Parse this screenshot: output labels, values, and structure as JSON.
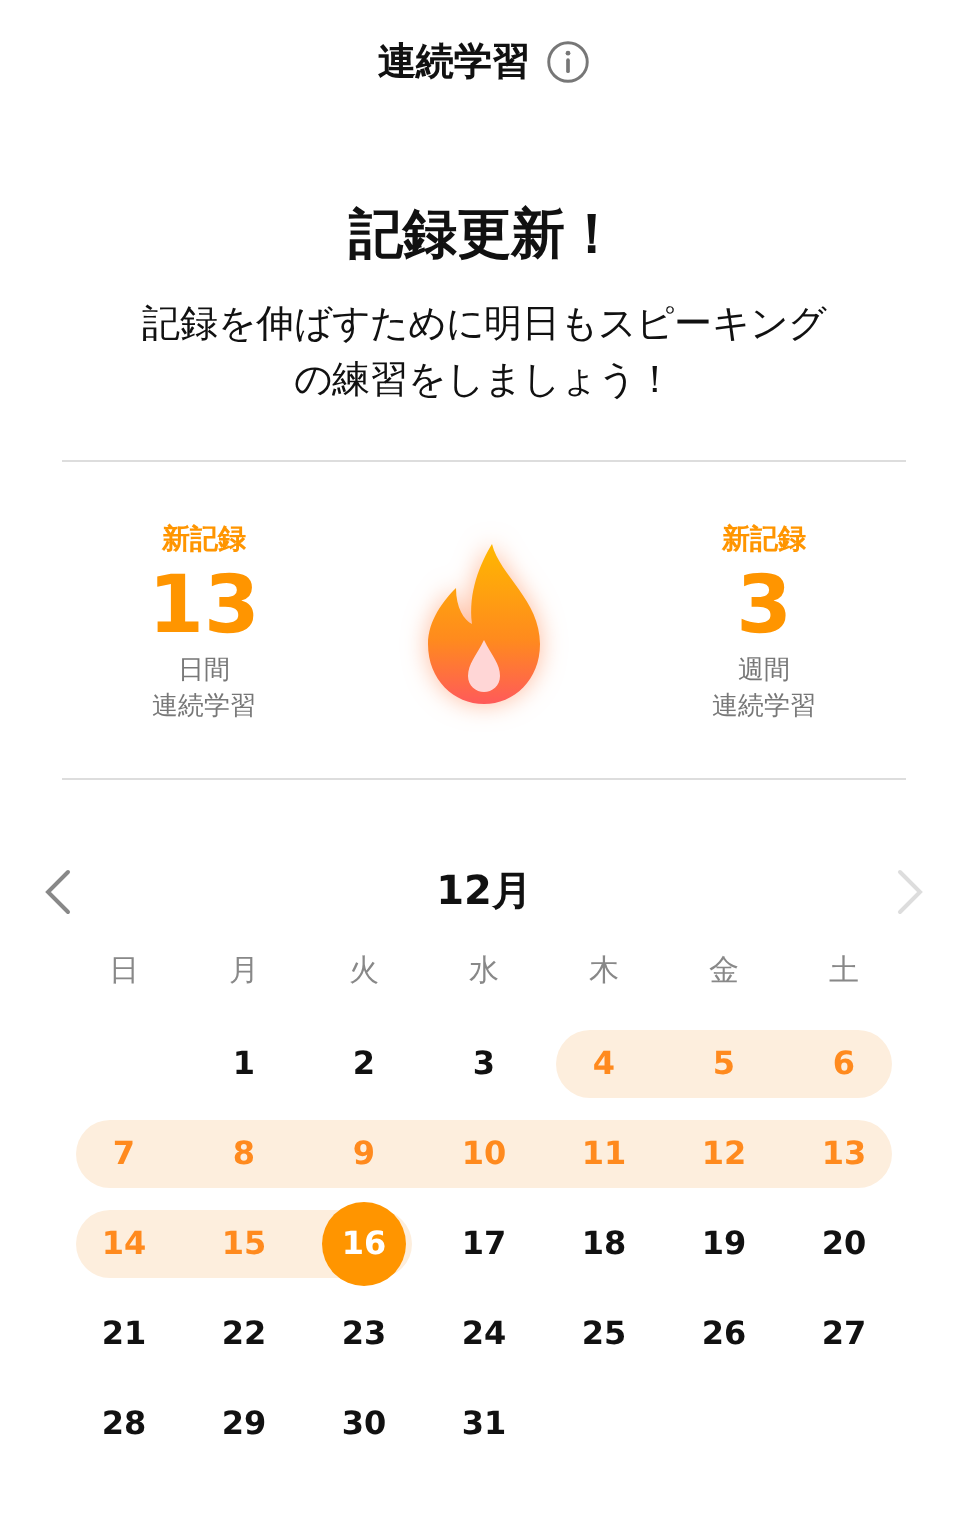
{
  "header": {
    "title": "連続学習"
  },
  "headline": "記録更新！",
  "message": "記録を伸ばすために明日もスピーキングの練習をしましょう！",
  "stats": [
    {
      "badge": "新記録",
      "value": "13",
      "unit": "日間",
      "label": "連続学習"
    },
    {
      "badge": "新記録",
      "value": "3",
      "unit": "週間",
      "label": "連続学習"
    }
  ],
  "calendar": {
    "month": "12月",
    "prev": {
      "disabled": false
    },
    "next": {
      "disabled": true
    },
    "weekdays": [
      "日",
      "月",
      "火",
      "水",
      "木",
      "金",
      "土"
    ],
    "weeks": [
      [
        {
          "kind": "blank"
        },
        {
          "kind": "day",
          "day": "1",
          "streak": false,
          "today": false
        },
        {
          "kind": "day",
          "day": "2",
          "streak": false,
          "today": false
        },
        {
          "kind": "day",
          "day": "3",
          "streak": false,
          "today": false
        },
        {
          "kind": "day",
          "day": "4",
          "streak": true,
          "today": false
        },
        {
          "kind": "day",
          "day": "5",
          "streak": true,
          "today": false
        },
        {
          "kind": "day",
          "day": "6",
          "streak": true,
          "today": false
        }
      ],
      [
        {
          "kind": "day",
          "day": "7",
          "streak": true,
          "today": false
        },
        {
          "kind": "day",
          "day": "8",
          "streak": true,
          "today": false
        },
        {
          "kind": "day",
          "day": "9",
          "streak": true,
          "today": false
        },
        {
          "kind": "day",
          "day": "10",
          "streak": true,
          "today": false
        },
        {
          "kind": "day",
          "day": "11",
          "streak": true,
          "today": false
        },
        {
          "kind": "day",
          "day": "12",
          "streak": true,
          "today": false
        },
        {
          "kind": "day",
          "day": "13",
          "streak": true,
          "today": false
        }
      ],
      [
        {
          "kind": "day",
          "day": "14",
          "streak": true,
          "today": false
        },
        {
          "kind": "day",
          "day": "15",
          "streak": true,
          "today": false
        },
        {
          "kind": "day",
          "day": "16",
          "streak": true,
          "today": true
        },
        {
          "kind": "day",
          "day": "17",
          "streak": false,
          "today": false
        },
        {
          "kind": "day",
          "day": "18",
          "streak": false,
          "today": false
        },
        {
          "kind": "day",
          "day": "19",
          "streak": false,
          "today": false
        },
        {
          "kind": "day",
          "day": "20",
          "streak": false,
          "today": false
        }
      ],
      [
        {
          "kind": "day",
          "day": "21",
          "streak": false,
          "today": false
        },
        {
          "kind": "day",
          "day": "22",
          "streak": false,
          "today": false
        },
        {
          "kind": "day",
          "day": "23",
          "streak": false,
          "today": false
        },
        {
          "kind": "day",
          "day": "24",
          "streak": false,
          "today": false
        },
        {
          "kind": "day",
          "day": "25",
          "streak": false,
          "today": false
        },
        {
          "kind": "day",
          "day": "26",
          "streak": false,
          "today": false
        },
        {
          "kind": "day",
          "day": "27",
          "streak": false,
          "today": false
        }
      ],
      [
        {
          "kind": "day",
          "day": "28",
          "streak": false,
          "today": false
        },
        {
          "kind": "day",
          "day": "29",
          "streak": false,
          "today": false
        },
        {
          "kind": "day",
          "day": "30",
          "streak": false,
          "today": false
        },
        {
          "kind": "day",
          "day": "31",
          "streak": false,
          "today": false
        }
      ]
    ]
  }
}
